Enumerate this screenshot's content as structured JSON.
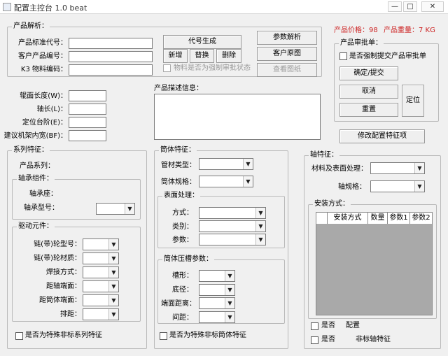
{
  "window": {
    "title": "配置主控台 1.0 beat",
    "min": "—",
    "max": "□",
    "close": "✕"
  },
  "product_parse": {
    "group": "产品解析：",
    "std_code_label": "产品标准代号：",
    "customer_code_label": "客户产品编号：",
    "k3_label": "K3 物料编码：",
    "std_code_value": "",
    "customer_code_value": "",
    "k3_value": "",
    "gen_code_btn": "代号生成",
    "add_btn": "新增",
    "replace_btn": "替换",
    "delete_btn": "删除",
    "force_approval_label": "物料是否为强制审批状态",
    "param_parse_btn": "参数解析",
    "customer_drawing_btn": "客户原图",
    "view_drawing_btn": "查看图纸"
  },
  "price": {
    "price_label": "产品价格：98",
    "weight_label": "产品重量：7 KG"
  },
  "approval": {
    "group": "产品审批单：",
    "force_submit_label": "是否强制提交产品审批单",
    "confirm_btn": "确定/提交",
    "cancel_btn": "取消",
    "reset_btn": "重置",
    "locate_btn": "定位",
    "modify_btn": "修改配置特征项"
  },
  "dims": {
    "roller_len_label": "辊面长度(W)：",
    "shaft_len_label": "轴长(L)：",
    "step_label": "定位台阶(E)：",
    "frame_width_label": "建议机架内宽(BF)：",
    "roller_len": "",
    "shaft_len": "",
    "step": "",
    "frame_width": ""
  },
  "description": {
    "label": "产品描述信息：",
    "value": ""
  },
  "series": {
    "group": "系列特征：",
    "series_label": "产品系列：",
    "bearing_group": "轴承组件：",
    "bearing_seat_label": "轴承座：",
    "bearing_model_label": "轴承型号：",
    "bearing_model_value": "",
    "drive_group": "驱动元件：",
    "chain_model_label": "链(带)轮型号：",
    "chain_material_label": "链(带)轮材质：",
    "weld_label": "焊接方式：",
    "shaft_end_label": "距轴端面：",
    "tube_end_label": "距筒体端面：",
    "row_pitch_label": "排距：",
    "special_label": "是否为特殊非标系列特征"
  },
  "tube": {
    "group": "筒体特征：",
    "material_type_label": "管材类型：",
    "spec_label": "筒体规格：",
    "surface_group": "表面处理：",
    "method_label": "方式：",
    "category_label": "类别：",
    "param_label": "参数：",
    "groove_group": "筒体压槽参数：",
    "groove_shape_label": "槽形：",
    "bottom_dia_label": "底径：",
    "end_dist_label": "端面距离：",
    "spacing_label": "间距：",
    "special_label": "是否为特殊非标筒体特征"
  },
  "shaft": {
    "group": "轴特征：",
    "material_surface_label": "材料及表面处理：",
    "shaft_spec_label": "轴规格：",
    "install_group": "安装方式：",
    "columns": [
      "安装方式",
      "数量",
      "参数1",
      "参数2"
    ],
    "bottom_check1": "是否",
    "bottom_check1_tail": "配置",
    "bottom_check2": "是否",
    "bottom_check2_tail": "非标轴特征"
  }
}
